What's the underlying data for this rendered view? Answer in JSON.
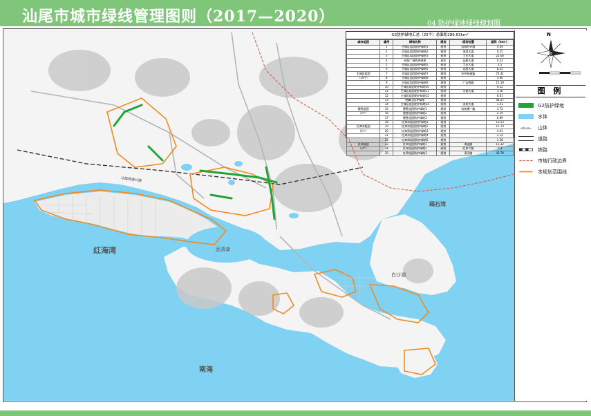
{
  "header": {
    "title": "汕尾市城市绿线管理图则（2017—2020）",
    "sheet": "04  防护绿地绿线规划图"
  },
  "map": {
    "labels": {
      "honghai_bay": "红海湾",
      "pinqing_lake": "品清湖",
      "baisha_lake": "白沙湖",
      "bishi_bay": "碣石湾",
      "south_sea": "南海"
    },
    "road_labels": {
      "shenshan_road": "汕尾高速公路"
    }
  },
  "table": {
    "title": "G2防护绿地汇总（25个）总面积286.63hm²",
    "headers": [
      "城市组团",
      "编号",
      "绿地名称",
      "规划",
      "规划位置",
      "面积（hm²）"
    ],
    "rows": [
      [
        "",
        "1",
        "主城区组团防护绿地1",
        "规划",
        "西城外环路",
        "4.04"
      ],
      [
        "",
        "2",
        "主城区组团防护绿地2",
        "规划",
        "海滨大道",
        "0.25"
      ],
      [
        "",
        "3",
        "主城区组团防护绿地3",
        "规划",
        "工业大道",
        "22.66"
      ],
      [
        "",
        "4",
        "州前广场防护绿地",
        "现状",
        "汕尾大道",
        "0.22"
      ],
      [
        "",
        "5",
        "主城区组团防护绿地5",
        "规划",
        "工业大道",
        "2.5"
      ],
      [
        "",
        "6",
        "主城区组团防护绿地6",
        "规划",
        "汕尾大道",
        "8.25"
      ],
      [
        "主城区组团",
        "7",
        "主城区组团防护绿地7",
        "规划",
        "外环快速路",
        "72.41"
      ],
      [
        "（14个）",
        "8",
        "主城区组团防护绿地8",
        "规划",
        "",
        "3.66"
      ],
      [
        "",
        "9",
        "主城区组团防护绿地9",
        "规划",
        "广汕铁路",
        "15.19"
      ],
      [
        "",
        "10",
        "主城区组团防护绿地10",
        "规划",
        "",
        "0.52"
      ],
      [
        "",
        "11",
        "主城区组团防护绿地11",
        "规划",
        "河堤大道",
        "3.16"
      ],
      [
        "",
        "12",
        "主城区组团防护绿地12",
        "规划",
        "",
        "6.61"
      ],
      [
        "",
        "13",
        "德峰山防护绿地",
        "规划",
        "",
        "44.27"
      ],
      [
        "",
        "14",
        "主城区组团防护绿地14",
        "规划",
        "滨莱大道",
        "1.41"
      ],
      [
        "捷胜组团",
        "15",
        "捷胜组团防护绿地1",
        "规划",
        "站前横一路",
        "1.72"
      ],
      [
        "（3个）",
        "16",
        "捷胜组团防护绿地2",
        "规划",
        "",
        "2.19"
      ],
      [
        "",
        "17",
        "捷胜组团防护绿地3",
        "规划",
        "",
        "0.89"
      ],
      [
        "",
        "18",
        "红海湾组团防护绿地1",
        "规划",
        "",
        "13.53"
      ],
      [
        "红海湾组团",
        "19",
        "红海湾组团防护绿地2",
        "规划",
        "",
        "12.74"
      ],
      [
        "（5个）",
        "20",
        "红海湾组团防护绿地3",
        "规划",
        "",
        "4.41"
      ],
      [
        "",
        "21",
        "红海湾组团防护绿地4",
        "规划",
        "",
        "2.14"
      ],
      [
        "",
        "22",
        "红海湾组团防护绿地5",
        "规划",
        "",
        "1.38"
      ],
      [
        "红草组团",
        "23",
        "红草组团防护绿地1",
        "规划",
        "海油路",
        "11.32"
      ],
      [
        "（3个）",
        "24",
        "红草组团防护绿地2",
        "规划",
        "红草二路",
        "0.4"
      ],
      [
        "",
        "25",
        "红草组团防护绿地3",
        "规划",
        "滨河路",
        "43.79"
      ]
    ]
  },
  "compass": {
    "north": "N"
  },
  "legend": {
    "title": "图 例",
    "items": [
      {
        "label": "G2防护绿地",
        "color": "#21a436"
      },
      {
        "label": "水体",
        "color": "#7fd2f2"
      },
      {
        "label": "山体",
        "color": "#b8b8b8"
      },
      {
        "label": "道路",
        "color": "#ffffff"
      },
      {
        "label": "铁路",
        "color": "#222222"
      },
      {
        "label": "市辖行政边界",
        "color": "#d9533c"
      },
      {
        "label": "本规划范围线",
        "color": "#f08a1e"
      }
    ]
  },
  "colors": {
    "band": "#7fc57a",
    "sea": "#7fd2f2",
    "land": "#f4f4f4",
    "hill": "#c8c8c8",
    "green_belt": "#21a436",
    "plan_boundary": "#f08a1e",
    "admin_boundary": "#d9533c"
  }
}
